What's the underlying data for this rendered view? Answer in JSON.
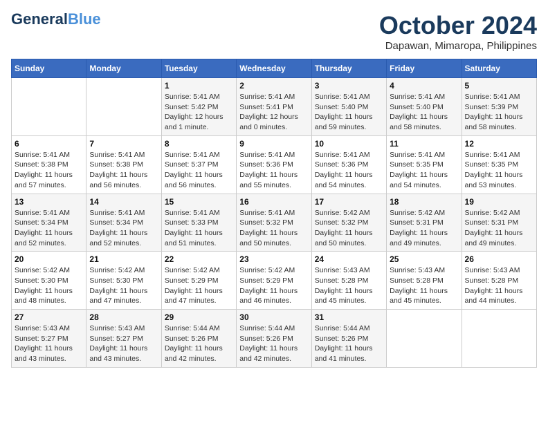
{
  "logo": {
    "line1": "General",
    "line2": "Blue",
    "tagline": ""
  },
  "title": "October 2024",
  "location": "Dapawan, Mimaropa, Philippines",
  "headers": [
    "Sunday",
    "Monday",
    "Tuesday",
    "Wednesday",
    "Thursday",
    "Friday",
    "Saturday"
  ],
  "weeks": [
    [
      {
        "day": "",
        "info": ""
      },
      {
        "day": "",
        "info": ""
      },
      {
        "day": "1",
        "info": "Sunrise: 5:41 AM\nSunset: 5:42 PM\nDaylight: 12 hours\nand 1 minute."
      },
      {
        "day": "2",
        "info": "Sunrise: 5:41 AM\nSunset: 5:41 PM\nDaylight: 12 hours\nand 0 minutes."
      },
      {
        "day": "3",
        "info": "Sunrise: 5:41 AM\nSunset: 5:40 PM\nDaylight: 11 hours\nand 59 minutes."
      },
      {
        "day": "4",
        "info": "Sunrise: 5:41 AM\nSunset: 5:40 PM\nDaylight: 11 hours\nand 58 minutes."
      },
      {
        "day": "5",
        "info": "Sunrise: 5:41 AM\nSunset: 5:39 PM\nDaylight: 11 hours\nand 58 minutes."
      }
    ],
    [
      {
        "day": "6",
        "info": "Sunrise: 5:41 AM\nSunset: 5:38 PM\nDaylight: 11 hours\nand 57 minutes."
      },
      {
        "day": "7",
        "info": "Sunrise: 5:41 AM\nSunset: 5:38 PM\nDaylight: 11 hours\nand 56 minutes."
      },
      {
        "day": "8",
        "info": "Sunrise: 5:41 AM\nSunset: 5:37 PM\nDaylight: 11 hours\nand 56 minutes."
      },
      {
        "day": "9",
        "info": "Sunrise: 5:41 AM\nSunset: 5:36 PM\nDaylight: 11 hours\nand 55 minutes."
      },
      {
        "day": "10",
        "info": "Sunrise: 5:41 AM\nSunset: 5:36 PM\nDaylight: 11 hours\nand 54 minutes."
      },
      {
        "day": "11",
        "info": "Sunrise: 5:41 AM\nSunset: 5:35 PM\nDaylight: 11 hours\nand 54 minutes."
      },
      {
        "day": "12",
        "info": "Sunrise: 5:41 AM\nSunset: 5:35 PM\nDaylight: 11 hours\nand 53 minutes."
      }
    ],
    [
      {
        "day": "13",
        "info": "Sunrise: 5:41 AM\nSunset: 5:34 PM\nDaylight: 11 hours\nand 52 minutes."
      },
      {
        "day": "14",
        "info": "Sunrise: 5:41 AM\nSunset: 5:34 PM\nDaylight: 11 hours\nand 52 minutes."
      },
      {
        "day": "15",
        "info": "Sunrise: 5:41 AM\nSunset: 5:33 PM\nDaylight: 11 hours\nand 51 minutes."
      },
      {
        "day": "16",
        "info": "Sunrise: 5:41 AM\nSunset: 5:32 PM\nDaylight: 11 hours\nand 50 minutes."
      },
      {
        "day": "17",
        "info": "Sunrise: 5:42 AM\nSunset: 5:32 PM\nDaylight: 11 hours\nand 50 minutes."
      },
      {
        "day": "18",
        "info": "Sunrise: 5:42 AM\nSunset: 5:31 PM\nDaylight: 11 hours\nand 49 minutes."
      },
      {
        "day": "19",
        "info": "Sunrise: 5:42 AM\nSunset: 5:31 PM\nDaylight: 11 hours\nand 49 minutes."
      }
    ],
    [
      {
        "day": "20",
        "info": "Sunrise: 5:42 AM\nSunset: 5:30 PM\nDaylight: 11 hours\nand 48 minutes."
      },
      {
        "day": "21",
        "info": "Sunrise: 5:42 AM\nSunset: 5:30 PM\nDaylight: 11 hours\nand 47 minutes."
      },
      {
        "day": "22",
        "info": "Sunrise: 5:42 AM\nSunset: 5:29 PM\nDaylight: 11 hours\nand 47 minutes."
      },
      {
        "day": "23",
        "info": "Sunrise: 5:42 AM\nSunset: 5:29 PM\nDaylight: 11 hours\nand 46 minutes."
      },
      {
        "day": "24",
        "info": "Sunrise: 5:43 AM\nSunset: 5:28 PM\nDaylight: 11 hours\nand 45 minutes."
      },
      {
        "day": "25",
        "info": "Sunrise: 5:43 AM\nSunset: 5:28 PM\nDaylight: 11 hours\nand 45 minutes."
      },
      {
        "day": "26",
        "info": "Sunrise: 5:43 AM\nSunset: 5:28 PM\nDaylight: 11 hours\nand 44 minutes."
      }
    ],
    [
      {
        "day": "27",
        "info": "Sunrise: 5:43 AM\nSunset: 5:27 PM\nDaylight: 11 hours\nand 43 minutes."
      },
      {
        "day": "28",
        "info": "Sunrise: 5:43 AM\nSunset: 5:27 PM\nDaylight: 11 hours\nand 43 minutes."
      },
      {
        "day": "29",
        "info": "Sunrise: 5:44 AM\nSunset: 5:26 PM\nDaylight: 11 hours\nand 42 minutes."
      },
      {
        "day": "30",
        "info": "Sunrise: 5:44 AM\nSunset: 5:26 PM\nDaylight: 11 hours\nand 42 minutes."
      },
      {
        "day": "31",
        "info": "Sunrise: 5:44 AM\nSunset: 5:26 PM\nDaylight: 11 hours\nand 41 minutes."
      },
      {
        "day": "",
        "info": ""
      },
      {
        "day": "",
        "info": ""
      }
    ]
  ]
}
